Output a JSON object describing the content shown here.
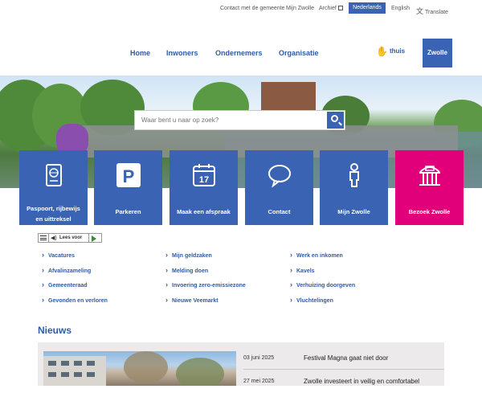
{
  "topbar": {
    "contact": "Contact met de gemeente",
    "mijn_zwolle": "Mijn Zwolle",
    "archief": "Archief",
    "lang_nl": "Nederlands",
    "lang_en": "English",
    "translate": "Translate"
  },
  "nav": {
    "items": [
      "Home",
      "Inwoners",
      "Ondernemers",
      "Organisatie"
    ],
    "thuis": "thuis",
    "logo": "Zwolle"
  },
  "search": {
    "placeholder": "Waar bent u naar op zoek?"
  },
  "tiles": [
    {
      "label": "Paspoort, rijbewijs en uittreksel",
      "icon": "passport-icon"
    },
    {
      "label": "Parkeren",
      "icon": "parking-icon"
    },
    {
      "label": "Maak een afspraak",
      "icon": "calendar-icon",
      "icon_text": "17"
    },
    {
      "label": "Contact",
      "icon": "speech-bubble-icon"
    },
    {
      "label": "Mijn Zwolle",
      "icon": "person-icon"
    },
    {
      "label": "Bezoek Zwolle",
      "icon": "building-icon"
    }
  ],
  "colors": {
    "primary": "#3a64b3",
    "accent": "#e2007a",
    "news_bg": "#eceaea"
  },
  "readbar": {
    "label": "Lees voor"
  },
  "quicklinks": {
    "col1": [
      "Vacatures",
      "Afvalinzameling",
      "Gemeenteraad",
      "Gevonden en verloren"
    ],
    "col2": [
      "Mijn geldzaken",
      "Melding doen",
      "Invoering zero-emissiezone",
      "Nieuwe Veemarkt"
    ],
    "col3": [
      "Werk en inkomen",
      "Kavels",
      "Verhuizing doorgeven",
      "Vluchtelingen"
    ]
  },
  "news": {
    "title": "Nieuws",
    "items": [
      {
        "date": "03 juni 2025",
        "headline": "Festival Magna gaat niet door"
      },
      {
        "date": "27 mei 2025",
        "headline": "Zwolle investeert in veilig en comfortabel"
      }
    ]
  }
}
